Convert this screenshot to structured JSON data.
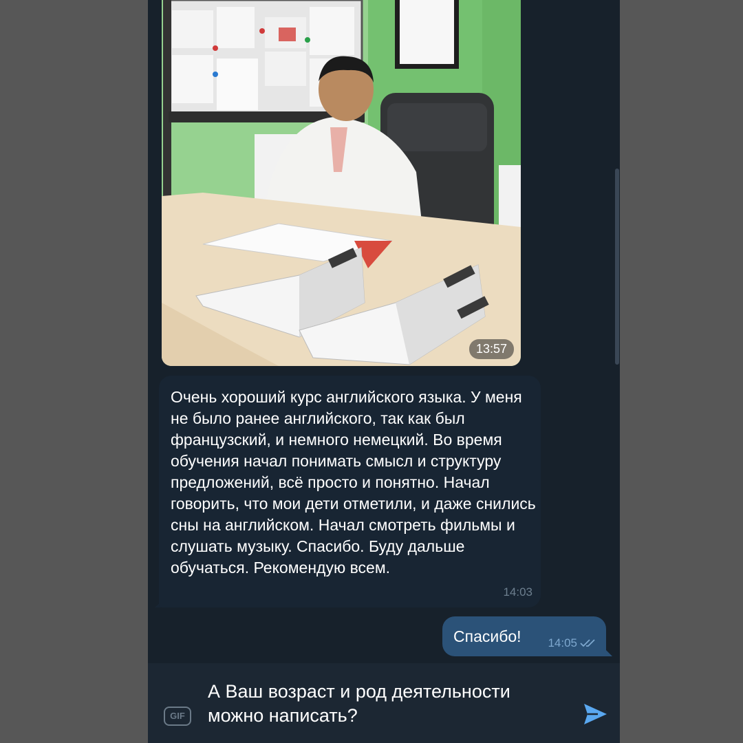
{
  "photo_message": {
    "time": "13:57"
  },
  "incoming_message": {
    "text": "Очень хороший курс английского языка. У меня не было ранее английского, так как был французский, и немного немецкий. Во время обучения начал понимать смысл и структуру предложений, всё просто и понятно. Начал говорить, что мои дети отметили, и даже снились сны на английском. Начал смотреть фильмы и слушать музыку. Спасибо. Буду дальше обучаться. Рекомендую всем.",
    "time": "14:03"
  },
  "outgoing_message": {
    "text": "Спасибо!",
    "time": "14:05",
    "status_icon": "double-check-icon"
  },
  "composer": {
    "gif_label": "GIF",
    "text": "А Ваш возраст и род деятельности можно написать?",
    "send_icon": "send-icon"
  },
  "colors": {
    "chat_bg": "#17212b",
    "incoming_bubble": "#182533",
    "outgoing_bubble": "#2b5278",
    "accent": "#5aa8f0"
  }
}
